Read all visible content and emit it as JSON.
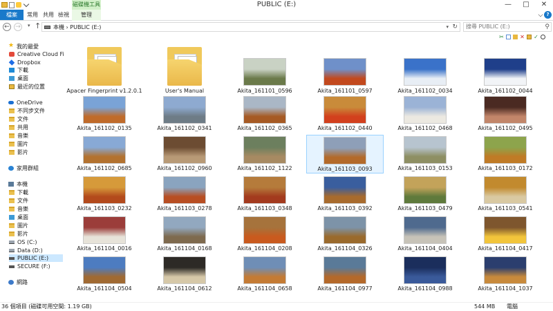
{
  "window": {
    "title": "PUBLIC (E:)",
    "context_tab": "磁碟機工具"
  },
  "ribbon": {
    "tabs": [
      "檔案",
      "常用",
      "共用",
      "檢視"
    ],
    "manage_tab": "管理"
  },
  "address": {
    "breadcrumb": "本機 › PUBLIC (E:)",
    "search_placeholder": "搜尋 PUBLIC (E:)"
  },
  "nav": {
    "favorites_header": "我的最愛",
    "favorites": [
      "Creative Cloud File",
      "Dropbox",
      "下載",
      "桌面",
      "最近的位置"
    ],
    "onedrive_header": "OneDrive",
    "onedrive_items": [
      "不同步文件",
      "文件",
      "共用",
      "音樂",
      "圖片",
      "影片"
    ],
    "homegroup": "家用群組",
    "thispc_header": "本機",
    "thispc_items": [
      "下載",
      "文件",
      "音樂",
      "桌面",
      "圖片",
      "影片"
    ],
    "drives": [
      "OS (C:)",
      "Data (D:)",
      "PUBLIC (E:)",
      "SECURE (F:)"
    ],
    "network": "網路"
  },
  "files": [
    {
      "name": "Apacer Fingerprint v1.2.0.1",
      "kind": "folder"
    },
    {
      "name": "User's Manual",
      "kind": "folder"
    },
    {
      "name": "Akita_161101_0596",
      "kind": "image"
    },
    {
      "name": "Akita_161101_0597",
      "kind": "image"
    },
    {
      "name": "Akita_161102_0034",
      "kind": "image"
    },
    {
      "name": "Akita_161102_0044",
      "kind": "image"
    },
    {
      "name": "Akita_161102_0135",
      "kind": "image"
    },
    {
      "name": "Akita_161102_0341",
      "kind": "image"
    },
    {
      "name": "Akita_161102_0365",
      "kind": "image"
    },
    {
      "name": "Akita_161102_0440",
      "kind": "image"
    },
    {
      "name": "Akita_161102_0468",
      "kind": "image"
    },
    {
      "name": "Akita_161102_0495",
      "kind": "image"
    },
    {
      "name": "Akita_161102_0685",
      "kind": "image"
    },
    {
      "name": "Akita_161102_0960",
      "kind": "image"
    },
    {
      "name": "Akita_161102_1122",
      "kind": "image"
    },
    {
      "name": "Akita_161103_0093",
      "kind": "image"
    },
    {
      "name": "Akita_161103_0153",
      "kind": "image"
    },
    {
      "name": "Akita_161103_0172",
      "kind": "image"
    },
    {
      "name": "Akita_161103_0232",
      "kind": "image"
    },
    {
      "name": "Akita_161103_0278",
      "kind": "image"
    },
    {
      "name": "Akita_161103_0348",
      "kind": "image"
    },
    {
      "name": "Akita_161103_0392",
      "kind": "image"
    },
    {
      "name": "Akita_161103_0479",
      "kind": "image"
    },
    {
      "name": "Akita_161103_0541",
      "kind": "image"
    },
    {
      "name": "Akita_161104_0016",
      "kind": "image"
    },
    {
      "name": "Akita_161104_0168",
      "kind": "image"
    },
    {
      "name": "Akita_161104_0208",
      "kind": "image"
    },
    {
      "name": "Akita_161104_0326",
      "kind": "image"
    },
    {
      "name": "Akita_161104_0404",
      "kind": "image"
    },
    {
      "name": "Akita_161104_0417",
      "kind": "image"
    },
    {
      "name": "Akita_161104_0504",
      "kind": "image"
    },
    {
      "name": "Akita_161104_0612",
      "kind": "image"
    },
    {
      "name": "Akita_161104_0658",
      "kind": "image"
    },
    {
      "name": "Akita_161104_0977",
      "kind": "image"
    },
    {
      "name": "Akita_161104_0988",
      "kind": "image"
    },
    {
      "name": "Akita_161104_1037",
      "kind": "image"
    }
  ],
  "thumb_colors": [
    [
      "#c9d2c4",
      "#6b7a4a"
    ],
    [
      "#6f90c9",
      "#c2491e"
    ],
    [
      "#3a72c9",
      "#e8eef5"
    ],
    [
      "#1f3f8a",
      "#f2f4f7"
    ],
    [
      "#7aa3d6",
      "#c06b2a"
    ],
    [
      "#8eaad0",
      "#6e7c86"
    ],
    [
      "#aab7c6",
      "#a65a24"
    ],
    [
      "#c98b3a",
      "#d2401d"
    ],
    [
      "#9bb3d6",
      "#ece9e1"
    ],
    [
      "#4a2a22",
      "#c2866a"
    ],
    [
      "#88a9d5",
      "#b3722f"
    ],
    [
      "#6c4c32",
      "#b89a76"
    ],
    [
      "#6c7f5e",
      "#a78a62"
    ],
    [
      "#8e9fb8",
      "#b36a2a"
    ],
    [
      "#b7c4cf",
      "#8e8f63"
    ],
    [
      "#8da44c",
      "#c07b26"
    ],
    [
      "#d69a3a",
      "#b34a1c"
    ],
    [
      "#8aa4bf",
      "#b84e22"
    ],
    [
      "#b57b3b",
      "#a33a1e"
    ],
    [
      "#3a5e9e",
      "#a86b2d"
    ],
    [
      "#c3a35a",
      "#5f7a3c"
    ],
    [
      "#c28a2e",
      "#d9c9a2"
    ],
    [
      "#9b3d3a",
      "#e7e3d9"
    ],
    [
      "#92a8bf",
      "#7e6a4e"
    ],
    [
      "#a6733c",
      "#c95a1e"
    ],
    [
      "#7d93a8",
      "#9a6a2c"
    ],
    [
      "#4f6a8e",
      "#c7c3b8"
    ],
    [
      "#7e562e",
      "#f2c53b"
    ],
    [
      "#4d7cc0",
      "#a06a32"
    ],
    [
      "#2d2a26",
      "#d6c8a8"
    ],
    [
      "#6f8eb6",
      "#c47b34"
    ],
    [
      "#5a7a98",
      "#b4692a"
    ],
    [
      "#1b2e5c",
      "#3a5a9a"
    ],
    [
      "#2b3e6e",
      "#c88a3c"
    ],
    [
      "#9a2a28",
      "#e7d8d2"
    ]
  ],
  "status": {
    "count": "36 個項目 (磁碟可用空間: 1.19 GB)",
    "size": "544 MB",
    "computer": "電腦"
  }
}
